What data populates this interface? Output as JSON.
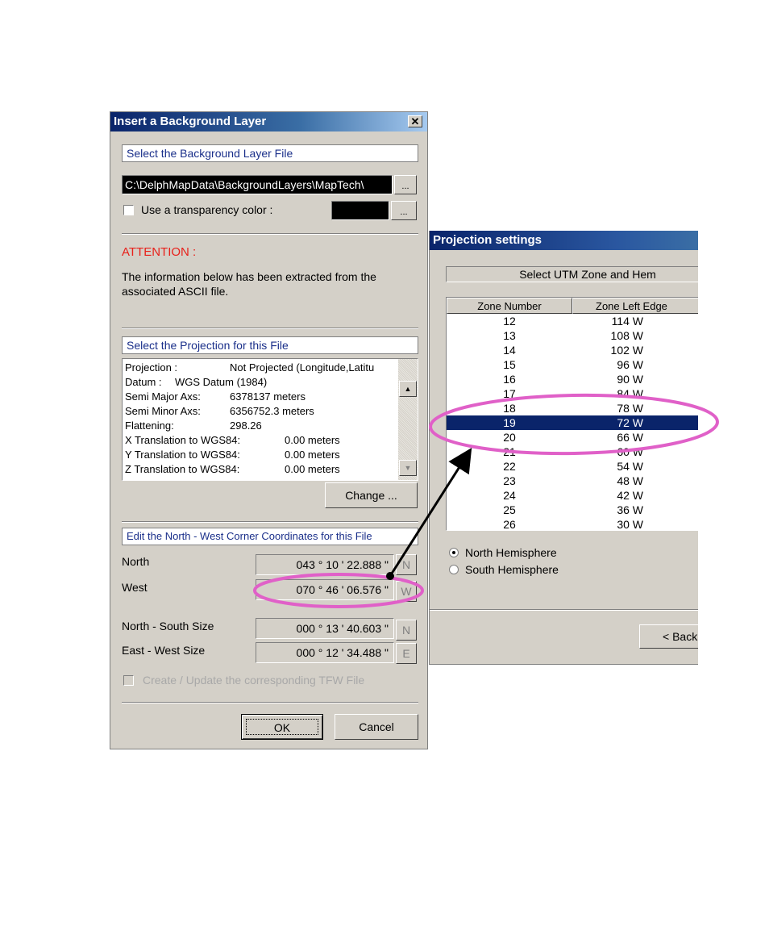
{
  "dialog1": {
    "title": "Insert a Background Layer",
    "file_group": "Select the Background Layer File",
    "file_path": "C:\\DelphMapData\\BackgroundLayers\\MapTech\\",
    "browse_label": "...",
    "transparency_label": "Use a transparency color :",
    "transparency_checked": false,
    "transparency_color": "#000000",
    "attention": "ATTENTION :",
    "info_line1": "The information below has been extracted from the",
    "info_line2": "associated ASCII file.",
    "projection_group": "Select the Projection for this File",
    "projection_info": [
      {
        "label": "Projection :",
        "value": "Not Projected (Longitude,Latitu"
      },
      {
        "label": "Datum :",
        "value": "WGS Datum (1984)"
      },
      {
        "label": "Semi Major Axs:",
        "value": "6378137 meters"
      },
      {
        "label": "Semi Minor Axs:",
        "value": "6356752.3 meters"
      },
      {
        "label": "Flattening:",
        "value": "298.26"
      },
      {
        "label": "X Translation to WGS84:",
        "value": "0.00 meters"
      },
      {
        "label": "Y Translation to WGS84:",
        "value": "0.00 meters"
      },
      {
        "label": "Z Translation to WGS84:",
        "value": "0.00 meters"
      }
    ],
    "change_label": "Change ...",
    "coords_group": "Edit the North - West Corner Coordinates for this File",
    "north_label": "North",
    "north_value": "043 ° 10 ' 22.888 \"",
    "north_dir": "N",
    "west_label": "West",
    "west_value": "070 ° 46 ' 06.576 \"",
    "west_dir": "W",
    "ns_size_label": "North - South Size",
    "ns_size_value": "000 ° 13 ' 40.603 \"",
    "ns_dir": "N",
    "ew_size_label": "East - West Size",
    "ew_size_value": "000 ° 12 ' 34.488 \"",
    "ew_dir": "E",
    "tfw_label": "Create / Update the corresponding TFW File",
    "ok_label": "OK",
    "cancel_label": "Cancel"
  },
  "dialog2": {
    "title": "Projection settings",
    "header": "Select UTM Zone and Hem",
    "col_zone": "Zone Number",
    "col_edge": "Zone Left Edge",
    "zones": [
      {
        "zone": "12",
        "edge": "114  W"
      },
      {
        "zone": "13",
        "edge": "108  W"
      },
      {
        "zone": "14",
        "edge": "102  W"
      },
      {
        "zone": "15",
        "edge": "96  W"
      },
      {
        "zone": "16",
        "edge": "90  W"
      },
      {
        "zone": "17",
        "edge": "84  W"
      },
      {
        "zone": "18",
        "edge": "78  W"
      },
      {
        "zone": "19",
        "edge": "72  W"
      },
      {
        "zone": "20",
        "edge": "66  W"
      },
      {
        "zone": "21",
        "edge": "60  W"
      },
      {
        "zone": "22",
        "edge": "54  W"
      },
      {
        "zone": "23",
        "edge": "48  W"
      },
      {
        "zone": "24",
        "edge": "42  W"
      },
      {
        "zone": "25",
        "edge": "36  W"
      },
      {
        "zone": "26",
        "edge": "30  W"
      }
    ],
    "selected_zone": "19",
    "north_hemi": "North Hemisphere",
    "south_hemi": "South Hemisphere",
    "hemisphere_selected": "North",
    "back_label": "< Back"
  },
  "annotation_color": "#e060c8",
  "selection_color": "#0a246a"
}
